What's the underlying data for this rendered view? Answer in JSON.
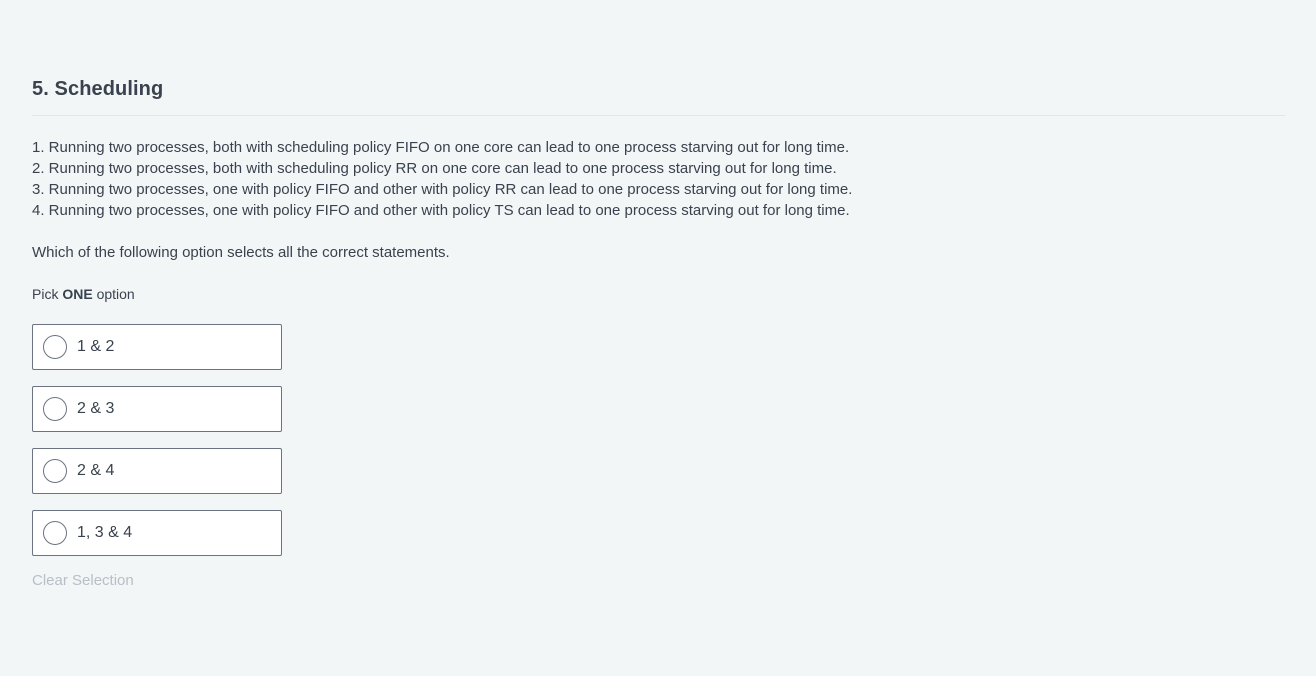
{
  "question": {
    "title": "5. Scheduling",
    "statements": [
      "1. Running two processes, both with scheduling policy FIFO on one core can lead to one process starving out for long time.",
      "2. Running two processes, both with scheduling policy RR on one core can lead to one process starving out for long time.",
      "3. Running two processes, one with policy FIFO and other with policy RR can lead to one process starving out for long time.",
      "4. Running two processes, one with policy FIFO and other with policy TS can lead to one process starving out for long time."
    ],
    "prompt": "Which of the following option selects all the correct statements.",
    "pick": {
      "prefix": "Pick",
      "emphasis": "ONE",
      "suffix": "option"
    },
    "options": [
      {
        "label": "1 & 2",
        "selected": false
      },
      {
        "label": "2 & 3",
        "selected": false
      },
      {
        "label": "2 & 4",
        "selected": false
      },
      {
        "label": "1, 3 & 4",
        "selected": false
      }
    ],
    "clear_label": "Clear Selection"
  },
  "colors": {
    "background": "#f3f6f7",
    "text": "#39424e",
    "border": "#6b7480",
    "muted": "#b7c0c6"
  }
}
